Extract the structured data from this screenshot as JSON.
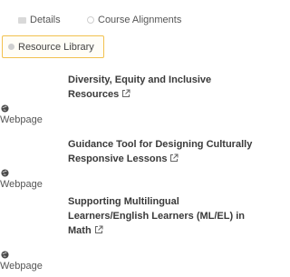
{
  "tabs": {
    "details": "Details",
    "course_alignments": "Course Alignments",
    "resource_library": "Resource Library"
  },
  "resources": [
    {
      "title": "Diversity, Equity and Inclusive Resources",
      "type": "Webpage"
    },
    {
      "title": "Guidance Tool for Designing Culturally Responsive Lessons",
      "type": "Webpage"
    },
    {
      "title": "Supporting Multilingual Learners/English Learners (ML/EL) in Math",
      "type": "Webpage"
    }
  ],
  "colors": {
    "active_tab_border": "#f2c14e",
    "title_text": "#3a3a3a"
  }
}
